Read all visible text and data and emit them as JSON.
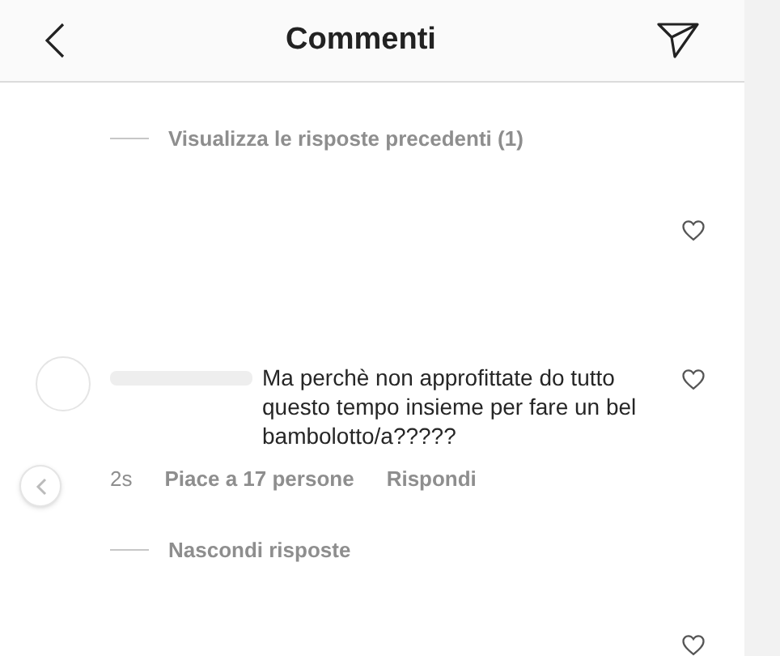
{
  "header": {
    "title": "Commenti"
  },
  "previous_replies": {
    "label": "Visualizza le risposte precedenti (1)"
  },
  "comment": {
    "text": "Ma perchè non approfittate do tutto questo tempo insieme per fare un bel bambolotto/a?????",
    "time": "2s",
    "likes": "Piace a 17 persone",
    "reply": "Rispondi",
    "liked": false
  },
  "hide_replies": {
    "label": "Nascondi risposte"
  }
}
